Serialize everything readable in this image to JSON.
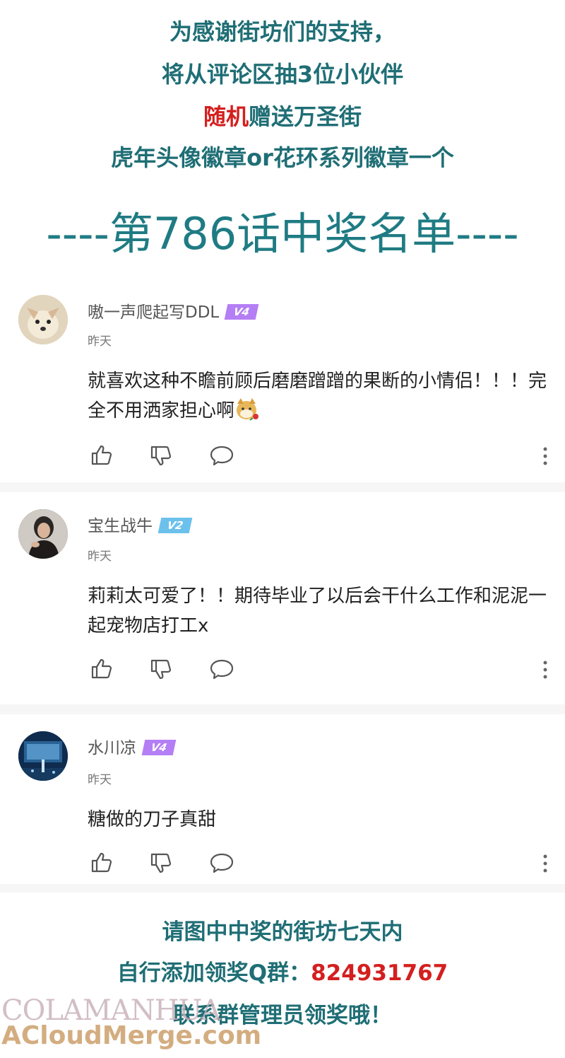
{
  "header": {
    "line1": "为感谢街坊们的支持，",
    "line2": "将从评论区抽3位小伙伴",
    "line3_red": "随机",
    "line3_rest": "赠送万圣街",
    "line4": "虎年头像徽章or花环系列徽章一个",
    "title": "----第786话中奖名单----"
  },
  "comments": [
    {
      "username": "嗷一声爬起写DDL",
      "badge": "V4",
      "badge_color": "#b47ef5",
      "date": "昨天",
      "text": "就喜欢这种不瞻前顾后磨磨蹭蹭的果断的小情侣！！！完全不用洒家担心啊",
      "emoji_icon": "doge-rose-emoji-icon"
    },
    {
      "username": "宝生战牛",
      "badge": "V2",
      "badge_color": "#6cc1ec",
      "date": "昨天",
      "text": "莉莉太可爱了！！期待毕业了以后会干什么工作和泥泥一起宠物店打工x"
    },
    {
      "username": "水川凉",
      "badge": "V4",
      "badge_color": "#b47ef5",
      "date": "昨天",
      "text": "糖做的刀子真甜"
    }
  ],
  "footer": {
    "line1": "请图中中奖的街坊七天内",
    "line2_prefix": "自行添加领奖Q群：",
    "line2_number": "824931767",
    "line3": "联系群管理员领奖哦！"
  },
  "watermark": {
    "line1": "COLAMANHUA",
    "line2": "ACloudMerge.com"
  },
  "colors": {
    "teal": "#1f6e75",
    "red": "#d41f1f"
  }
}
